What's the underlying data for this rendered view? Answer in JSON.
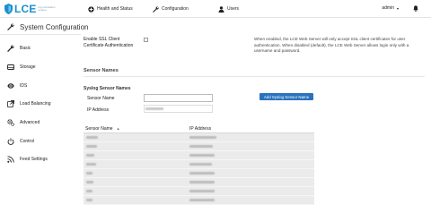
{
  "app": {
    "logo_text": "LCE",
    "logo_subtitle": "log correlation engine"
  },
  "nav": {
    "items": [
      {
        "label": "Health and Status",
        "icon": "plus-circle-icon"
      },
      {
        "label": "Configuration",
        "icon": "wrench-icon"
      },
      {
        "label": "Users",
        "icon": "user-icon"
      }
    ],
    "admin_label": "admin",
    "bell_icon": "bell-icon"
  },
  "page": {
    "title": "System Configuration",
    "title_icon": "wrench-icon"
  },
  "sidebar": {
    "items": [
      {
        "label": "Basic",
        "icon": "wrench-icon"
      },
      {
        "label": "Storage",
        "icon": "drive-icon"
      },
      {
        "label": "IDS",
        "icon": "eye-icon"
      },
      {
        "label": "Load Balancing",
        "icon": "external-link-icon"
      },
      {
        "label": "Advanced",
        "icon": "gears-icon"
      },
      {
        "label": "Control",
        "icon": "power-icon"
      },
      {
        "label": "Feed Settings",
        "icon": "rss-icon"
      }
    ]
  },
  "ssl": {
    "label_line1": "Enable SSL Client",
    "label_line2": "Certificate Authentication",
    "checked": false,
    "description": "When enabled, the LCE Web Server will only accept SSL client certificates for user authentication. When disabled (default), the LCE Web Server allows login only with a username and password."
  },
  "sensor_names": {
    "section_title": "Sensor Names",
    "syslog_title": "Syslog Sensor Names",
    "sensor_name_label": "Sensor Name",
    "ip_label": "IP Address",
    "sensor_name_value": "",
    "ip_value": "",
    "add_button": "Add Syslog Sensor Name"
  },
  "table": {
    "columns": [
      "Sensor Name",
      "IP Address"
    ],
    "sort_indicator": "▲",
    "rows": 8
  }
}
